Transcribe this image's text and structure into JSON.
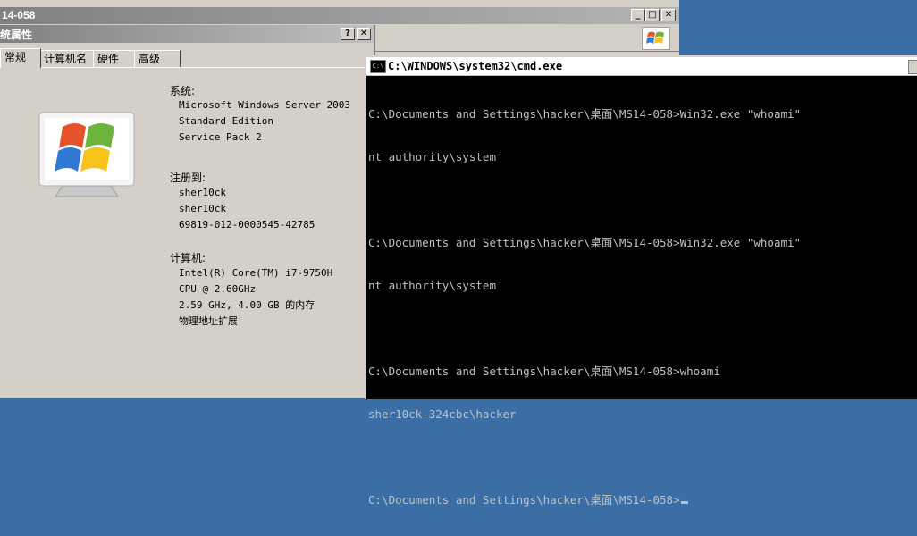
{
  "explorer": {
    "title": "14-058",
    "buttons": [
      "_",
      "□",
      "✕"
    ]
  },
  "sysprops": {
    "title": "统属性",
    "help": "?",
    "close": "✕",
    "tabs": [
      {
        "label": "常规",
        "active": true
      },
      {
        "label": "计算机名",
        "active": false
      },
      {
        "label": "硬件",
        "active": false
      },
      {
        "label": "高级",
        "active": false
      }
    ],
    "system_label": "系统:",
    "system_lines": [
      "Microsoft Windows Server 2003",
      "Standard Edition",
      "Service Pack 2"
    ],
    "registered_label": "注册到:",
    "registered_lines": [
      "sher10ck",
      "sher10ck",
      "69819-012-0000545-42785"
    ],
    "computer_label": "计算机:",
    "computer_lines": [
      "Intel(R) Core(TM) i7-9750H",
      "CPU @ 2.60GHz",
      "2.59 GHz, 4.00 GB 的内存",
      "物理地址扩展"
    ]
  },
  "cmd": {
    "icon_text": "C:\\",
    "title": "C:\\WINDOWS\\system32\\cmd.exe",
    "lines": [
      "C:\\Documents and Settings\\hacker\\桌面\\MS14-058>Win32.exe \"whoami\"",
      "nt authority\\system",
      "",
      "C:\\Documents and Settings\\hacker\\桌面\\MS14-058>Win32.exe \"whoami\"",
      "nt authority\\system",
      "",
      "C:\\Documents and Settings\\hacker\\桌面\\MS14-058>whoami",
      "sher10ck-324cbc\\hacker",
      "",
      "C:\\Documents and Settings\\hacker\\桌面\\MS14-058>"
    ]
  },
  "colors": {
    "desktop": "#3a6ea5",
    "window_face": "#d4d0c8",
    "console_bg": "#000000",
    "console_fg": "#c0c0c0"
  }
}
